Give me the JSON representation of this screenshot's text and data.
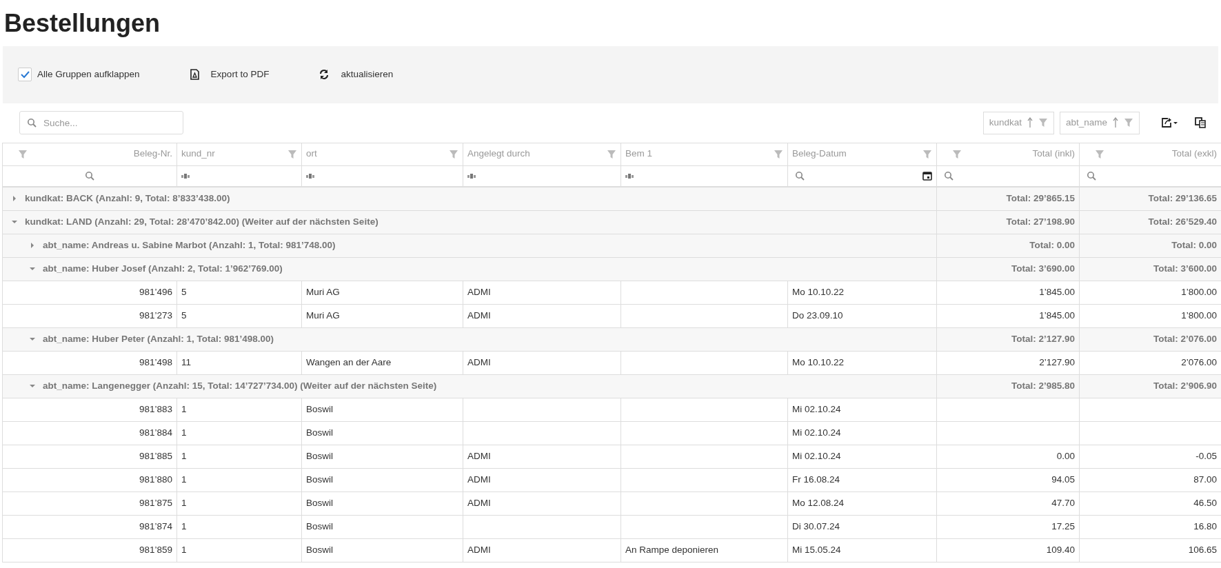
{
  "page_title": "Bestellungen",
  "toolbar": {
    "expand_all": {
      "label": "Alle Gruppen aufklappen",
      "checked": true
    },
    "buttons": [
      {
        "label": "Export to PDF",
        "kind": "pdf"
      },
      {
        "label": "aktualisieren",
        "kind": "refresh"
      }
    ]
  },
  "search": {
    "placeholder": "Suche..."
  },
  "group_chips": [
    {
      "label": "kundkat"
    },
    {
      "label": "abt_name"
    }
  ],
  "table": {
    "columns": [
      {
        "label": "Beleg-Nr.",
        "kind": "number"
      },
      {
        "label": "kund_nr",
        "kind": "text"
      },
      {
        "label": "ort",
        "kind": "text"
      },
      {
        "label": "Angelegt durch",
        "kind": "text"
      },
      {
        "label": "Bem 1",
        "kind": "text"
      },
      {
        "label": "Beleg-Datum",
        "kind": "date"
      },
      {
        "label": "Total (inkl)",
        "kind": "number"
      },
      {
        "label": "Total (exkl)",
        "kind": "number"
      }
    ],
    "groups": [
      {
        "kind": "group",
        "label": "kundkat: BACK (Anzahl: 9, Total: 8’833’438.00)",
        "expanded": false,
        "total_inkl": "Total: 29’865.15",
        "total_exkl": "Total: 29’136.65"
      },
      {
        "kind": "group",
        "label": "kundkat: LAND (Anzahl: 29, Total: 28’470’842.00) (Weiter auf der nächsten Seite)",
        "expanded": true,
        "total_inkl": "Total: 27’198.90",
        "total_exkl": "Total: 26’529.40",
        "children": [
          {
            "kind": "group",
            "label": "abt_name: Andreas u. Sabine Marbot (Anzahl: 1, Total: 981’748.00)",
            "expanded": false,
            "total_inkl": "Total: 0.00",
            "total_exkl": "Total: 0.00"
          },
          {
            "kind": "group",
            "label": "abt_name: Huber Josef (Anzahl: 2, Total: 1’962’769.00)",
            "expanded": true,
            "total_inkl": "Total: 3’690.00",
            "total_exkl": "Total: 3’600.00",
            "children": [
              {
                "kind": "row",
                "cells": [
                  "981’496",
                  "5",
                  "Muri AG",
                  "ADMI",
                  null,
                  "Mo 10.10.22",
                  "1’845.00",
                  "1’800.00"
                ]
              },
              {
                "kind": "row",
                "cells": [
                  "981’273",
                  "5",
                  "Muri AG",
                  "ADMI",
                  null,
                  "Do 23.09.10",
                  "1’845.00",
                  "1’800.00"
                ]
              }
            ]
          },
          {
            "kind": "group",
            "label": "abt_name: Huber Peter (Anzahl: 1, Total: 981’498.00)",
            "expanded": true,
            "total_inkl": "Total: 2’127.90",
            "total_exkl": "Total: 2’076.00",
            "children": [
              {
                "kind": "row",
                "cells": [
                  "981’498",
                  "11",
                  "Wangen an der Aare",
                  "ADMI",
                  null,
                  "Mo 10.10.22",
                  "2’127.90",
                  "2’076.00"
                ]
              }
            ]
          },
          {
            "kind": "group",
            "label": "abt_name: Langenegger (Anzahl: 15, Total: 14’727’734.00) (Weiter auf der nächsten Seite)",
            "expanded": true,
            "total_inkl": "Total: 2’985.80",
            "total_exkl": "Total: 2’906.90",
            "children": [
              {
                "kind": "row",
                "cells": [
                  "981’883",
                  "1",
                  "Boswil",
                  null,
                  null,
                  "Mi 02.10.24",
                  null,
                  null
                ]
              },
              {
                "kind": "row",
                "cells": [
                  "981’884",
                  "1",
                  "Boswil",
                  null,
                  null,
                  "Mi 02.10.24",
                  null,
                  null
                ]
              },
              {
                "kind": "row",
                "cells": [
                  "981’885",
                  "1",
                  "Boswil",
                  "ADMI",
                  null,
                  "Mi 02.10.24",
                  "0.00",
                  "-0.05"
                ]
              },
              {
                "kind": "row",
                "cells": [
                  "981’880",
                  "1",
                  "Boswil",
                  "ADMI",
                  null,
                  "Fr 16.08.24",
                  "94.05",
                  "87.00"
                ]
              },
              {
                "kind": "row",
                "cells": [
                  "981’875",
                  "1",
                  "Boswil",
                  "ADMI",
                  null,
                  "Mo 12.08.24",
                  "47.70",
                  "46.50"
                ]
              },
              {
                "kind": "row",
                "cells": [
                  "981’874",
                  "1",
                  "Boswil",
                  null,
                  null,
                  "Di 30.07.24",
                  "17.25",
                  "16.80"
                ]
              },
              {
                "kind": "row",
                "cells": [
                  "981’859",
                  "1",
                  "Boswil",
                  "ADMI",
                  "An Rampe deponieren",
                  "Mi 15.05.24",
                  "109.40",
                  "106.65"
                ]
              }
            ]
          }
        ]
      }
    ]
  }
}
